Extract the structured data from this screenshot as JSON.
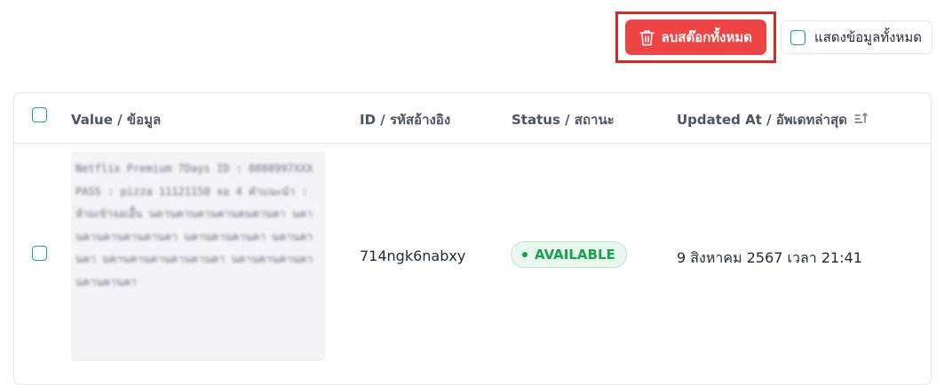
{
  "toolbar": {
    "delete_all_label": "ลบสต๊อกทั้งหมด",
    "show_all_label": "แสดงข้อมูลทั้งหมด"
  },
  "table": {
    "columns": [
      {
        "label": "Value / ข้อมูล"
      },
      {
        "label": "ID / รหัสอ้างอิง"
      },
      {
        "label": "Status / สถานะ"
      },
      {
        "label": "Updated At / อัพเดทล่าสุด"
      }
    ],
    "rows": [
      {
        "value": "Netflix Premium 7Days ID : 0888997XXX PASS : pizza 11121150 จอ 4 คำแนะนำ : ห้ามเข้าจอเอื้น นคานคานคานคานคนคานคา นคานคานคานคานคานคา นคานคานคานคา นคานคานคา นคานคานคานคานคานคา นคานคานคานคานคานคานคา",
        "id": "714ngk6nabxy",
        "status": "AVAILABLE",
        "updated_at": "9 สิงหาคม 2567 เวลา 21:41"
      }
    ]
  },
  "colors": {
    "danger": "#ef4444",
    "highlight": "#dc2626",
    "accent": "#0e9fb5",
    "available": "#16a34a"
  },
  "icons": {
    "delete": "trash-icon",
    "sort": "sort-icon"
  }
}
